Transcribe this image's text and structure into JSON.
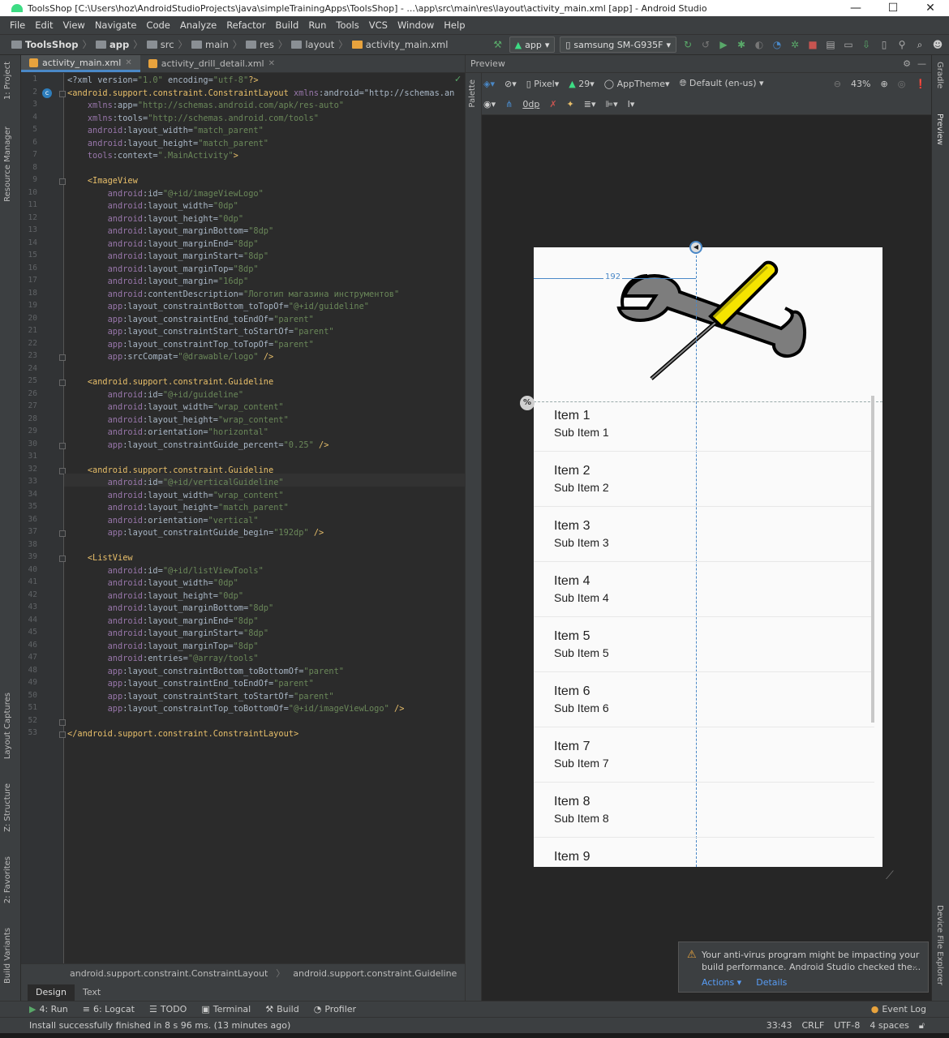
{
  "window": {
    "title": "ToolsShop [C:\\Users\\hoz\\AndroidStudioProjects\\java\\simpleTrainingApps\\ToolsShop] - ...\\app\\src\\main\\res\\layout\\activity_main.xml [app] - Android Studio",
    "minimize": "—",
    "maximize": "☐",
    "close": "✕"
  },
  "menu": [
    "File",
    "Edit",
    "View",
    "Navigate",
    "Code",
    "Analyze",
    "Refactor",
    "Build",
    "Run",
    "Tools",
    "VCS",
    "Window",
    "Help"
  ],
  "breadcrumbs": [
    "ToolsShop",
    "app",
    "src",
    "main",
    "res",
    "layout",
    "activity_main.xml"
  ],
  "run": {
    "module": "app",
    "device": "samsung SM-G935F"
  },
  "editor_tabs": [
    {
      "label": "activity_main.xml",
      "active": true
    },
    {
      "label": "activity_drill_detail.xml",
      "active": false
    }
  ],
  "left_tools": [
    "1: Project",
    "Resource Manager",
    "Layout Captures",
    "Z: Structure",
    "2: Favorites",
    "Build Variants"
  ],
  "right_tools": [
    "Gradle",
    "Preview",
    "Device File Explorer"
  ],
  "code_lines": [
    "<?xml version=\"1.0\" encoding=\"utf-8\"?>",
    "<android.support.constraint.ConstraintLayout xmlns:android=\"http://schemas.an",
    "    xmlns:app=\"http://schemas.android.com/apk/res-auto\"",
    "    xmlns:tools=\"http://schemas.android.com/tools\"",
    "    android:layout_width=\"match_parent\"",
    "    android:layout_height=\"match_parent\"",
    "    tools:context=\".MainActivity\">",
    "",
    "    <ImageView",
    "        android:id=\"@+id/imageViewLogo\"",
    "        android:layout_width=\"0dp\"",
    "        android:layout_height=\"0dp\"",
    "        android:layout_marginBottom=\"8dp\"",
    "        android:layout_marginEnd=\"8dp\"",
    "        android:layout_marginStart=\"8dp\"",
    "        android:layout_marginTop=\"8dp\"",
    "        android:layout_margin=\"16dp\"",
    "        android:contentDescription=\"Логотип магазина инструментов\"",
    "        app:layout_constraintBottom_toTopOf=\"@+id/guideline\"",
    "        app:layout_constraintEnd_toEndOf=\"parent\"",
    "        app:layout_constraintStart_toStartOf=\"parent\"",
    "        app:layout_constraintTop_toTopOf=\"parent\"",
    "        app:srcCompat=\"@drawable/logo\" />",
    "",
    "    <android.support.constraint.Guideline",
    "        android:id=\"@+id/guideline\"",
    "        android:layout_width=\"wrap_content\"",
    "        android:layout_height=\"wrap_content\"",
    "        android:orientation=\"horizontal\"",
    "        app:layout_constraintGuide_percent=\"0.25\" />",
    "",
    "    <android.support.constraint.Guideline",
    "        android:id=\"@+id/verticalGuideline\"",
    "        android:layout_width=\"wrap_content\"",
    "        android:layout_height=\"match_parent\"",
    "        android:orientation=\"vertical\"",
    "        app:layout_constraintGuide_begin=\"192dp\" />",
    "",
    "    <ListView",
    "        android:id=\"@+id/listViewTools\"",
    "        android:layout_width=\"0dp\"",
    "        android:layout_height=\"0dp\"",
    "        android:layout_marginBottom=\"8dp\"",
    "        android:layout_marginEnd=\"8dp\"",
    "        android:layout_marginStart=\"8dp\"",
    "        android:layout_marginTop=\"8dp\"",
    "        android:entries=\"@array/tools\"",
    "        app:layout_constraintBottom_toBottomOf=\"parent\"",
    "        app:layout_constraintEnd_toEndOf=\"parent\"",
    "        app:layout_constraintStart_toStartOf=\"parent\"",
    "        app:layout_constraintTop_toBottomOf=\"@+id/imageViewLogo\" />",
    "",
    "</android.support.constraint.ConstraintLayout>"
  ],
  "preview": {
    "title": "Preview",
    "device": "Pixel",
    "api": "29",
    "theme": "AppTheme",
    "locale": "Default (en-us)",
    "zoom": "43%",
    "margin": "0dp",
    "guide_value": "192",
    "percent_badge": "%",
    "items": [
      {
        "title": "Item 1",
        "sub": "Sub Item 1"
      },
      {
        "title": "Item 2",
        "sub": "Sub Item 2"
      },
      {
        "title": "Item 3",
        "sub": "Sub Item 3"
      },
      {
        "title": "Item 4",
        "sub": "Sub Item 4"
      },
      {
        "title": "Item 5",
        "sub": "Sub Item 5"
      },
      {
        "title": "Item 6",
        "sub": "Sub Item 6"
      },
      {
        "title": "Item 7",
        "sub": "Sub Item 7"
      },
      {
        "title": "Item 8",
        "sub": "Sub Item 8"
      },
      {
        "title": "Item 9",
        "sub": ""
      }
    ]
  },
  "component_tree": [
    "android.support.constraint.ConstraintLayout",
    "android.support.constraint.Guideline"
  ],
  "design_tabs": [
    {
      "label": "Design",
      "active": true
    },
    {
      "label": "Text",
      "active": false
    }
  ],
  "notification": {
    "text1": "Your anti-virus program might be impacting your",
    "text2": "build performance. Android Studio checked the...",
    "action1": "Actions",
    "action2": "Details"
  },
  "bottom_tools": [
    "4: Run",
    "6: Logcat",
    "TODO",
    "Terminal",
    "Build",
    "Profiler"
  ],
  "event_log": "Event Log",
  "status": {
    "message": "Install successfully finished in 8 s 96 ms. (13 minutes ago)",
    "position": "33:43",
    "line_sep": "CRLF",
    "encoding": "UTF-8",
    "indent": "4 spaces"
  }
}
